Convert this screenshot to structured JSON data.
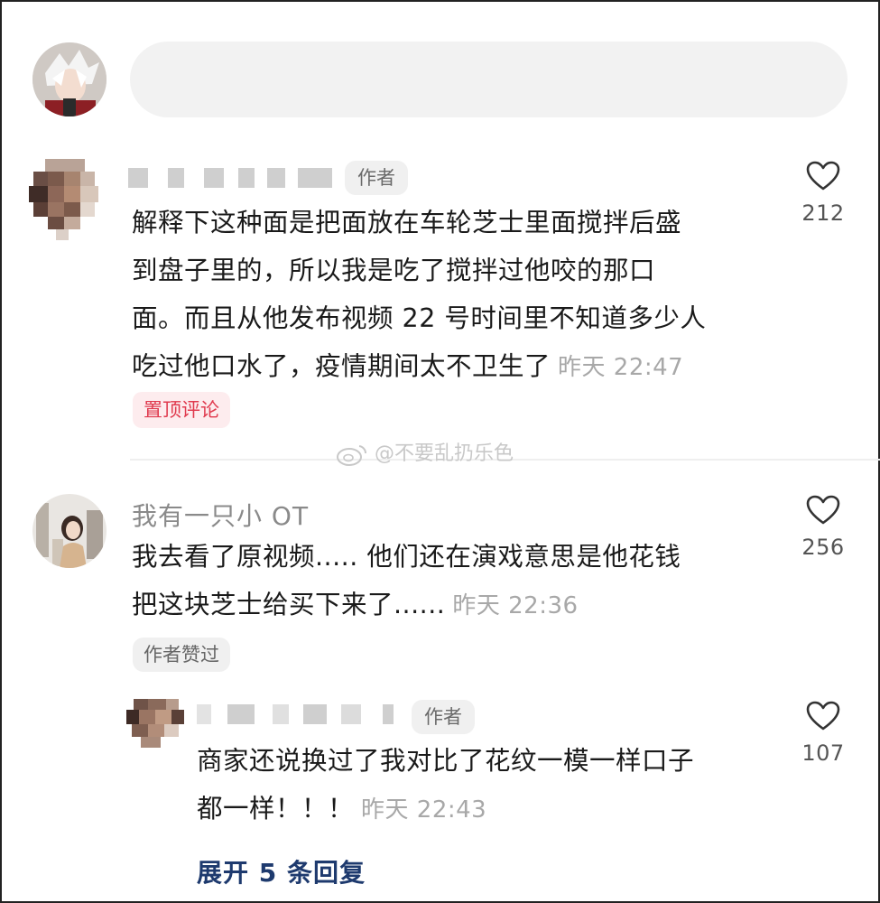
{
  "input": {
    "placeholder": ""
  },
  "comments": [
    {
      "author_tag": "作者",
      "text": "解释下这种面是把面放在车轮芝士里面搅拌后盛到盘子里的，所以我是吃了搅拌过他咬的那口面。而且从他发布视频22号时间里不知道多少人吃过他口水了，疫情期间太不卫生了",
      "lines": [
        "解释下这种面是把面放在车轮芝士里面搅拌后盛",
        "到盘子里的，所以我是吃了搅拌过他咬的那口",
        "面。而且从他发布视频 22 号时间里不知道多少人",
        "吃过他口水了，疫情期间太不卫生了"
      ],
      "time": "昨天 22:47",
      "likes": "212",
      "pin_label": "置顶评论"
    },
    {
      "username": "我有一只小 OT",
      "lines": [
        "我去看了原视频..... 他们还在演戏意思是他花钱",
        "把这块芝士给买下来了......"
      ],
      "time": "昨天 22:36",
      "likes": "256",
      "liked_label": "作者赞过"
    },
    {
      "author_tag": "作者",
      "lines": [
        "商家还说换过了我对比了花纹一模一样口子",
        "都一样！！！"
      ],
      "time": "昨天 22:43",
      "likes": "107"
    }
  ],
  "watermark": "@不要乱扔乐色",
  "expand_label": "展开 5 条回复",
  "icons": {
    "like": "heart-outline-icon",
    "weibo": "weibo-logo-icon"
  },
  "colors": {
    "pin": "#e03a4e",
    "expand": "#1e3a6e",
    "time": "#a8a8a8"
  }
}
